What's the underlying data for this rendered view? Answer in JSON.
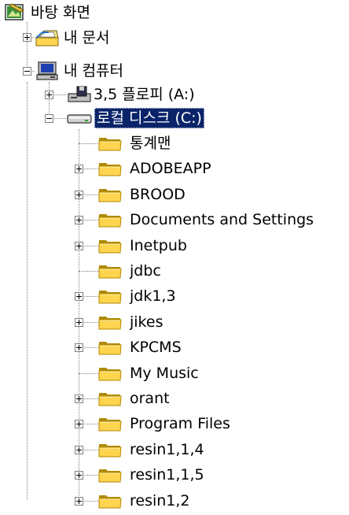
{
  "tree": {
    "root": {
      "label": "바탕 화면",
      "icon": "desktop-icon"
    },
    "level1": [
      {
        "label": "내 문서",
        "icon": "my-documents-icon",
        "expander": "plus"
      },
      {
        "label": "내 컴퓨터",
        "icon": "my-computer-icon",
        "expander": "minus"
      }
    ],
    "level2": [
      {
        "label": "3,5 플로피 (A:)",
        "icon": "floppy-drive-icon",
        "expander": "plus"
      },
      {
        "label": "로컬 디스크 (C:)",
        "icon": "hard-drive-icon",
        "expander": "minus",
        "selected": true
      }
    ],
    "folders": [
      {
        "label": "통계맨",
        "expander": "none"
      },
      {
        "label": "ADOBEAPP",
        "expander": "plus"
      },
      {
        "label": "BROOD",
        "expander": "plus"
      },
      {
        "label": "Documents and Settings",
        "expander": "plus"
      },
      {
        "label": "Inetpub",
        "expander": "plus"
      },
      {
        "label": "jdbc",
        "expander": "none"
      },
      {
        "label": "jdk1,3",
        "expander": "plus"
      },
      {
        "label": "jikes",
        "expander": "plus"
      },
      {
        "label": "KPCMS",
        "expander": "plus"
      },
      {
        "label": "My Music",
        "expander": "none"
      },
      {
        "label": "orant",
        "expander": "plus"
      },
      {
        "label": "Program Files",
        "expander": "plus"
      },
      {
        "label": "resin1,1,4",
        "expander": "plus"
      },
      {
        "label": "resin1,1,5",
        "expander": "plus"
      },
      {
        "label": "resin1,2",
        "expander": "plus"
      }
    ]
  },
  "colors": {
    "selection_bg": "#0a246a",
    "folder_fill": "#ffd44f",
    "folder_dark": "#b08a00"
  }
}
